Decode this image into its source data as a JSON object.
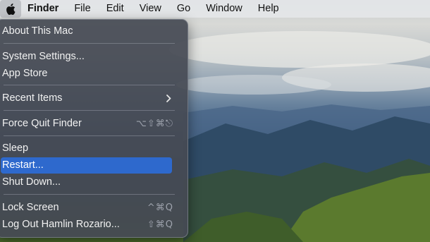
{
  "colors": {
    "menu_background": "#464a54",
    "selection": "#2e69cd",
    "menubar": "#e4e6e8",
    "shortcut_text": "#9ea3ad"
  },
  "menubar": {
    "apple_icon": "apple-logo-icon",
    "items": [
      "Finder",
      "File",
      "Edit",
      "View",
      "Go",
      "Window",
      "Help"
    ]
  },
  "apple_menu": {
    "items": [
      {
        "label": "About This Mac"
      },
      {
        "label": "System Settings..."
      },
      {
        "label": "App Store"
      },
      {
        "label": "Recent Items",
        "submenu_icon": "chevron-right-icon"
      },
      {
        "label": "Force Quit Finder",
        "shortcut": "⌥⇧⌘⎋"
      },
      {
        "label": "Sleep"
      },
      {
        "label": "Restart...",
        "selected": true
      },
      {
        "label": "Shut Down..."
      },
      {
        "label": "Lock Screen",
        "shortcut": "^⌘Q"
      },
      {
        "label": "Log Out Hamlin Rozario...",
        "shortcut": "⇧⌘Q"
      }
    ]
  }
}
